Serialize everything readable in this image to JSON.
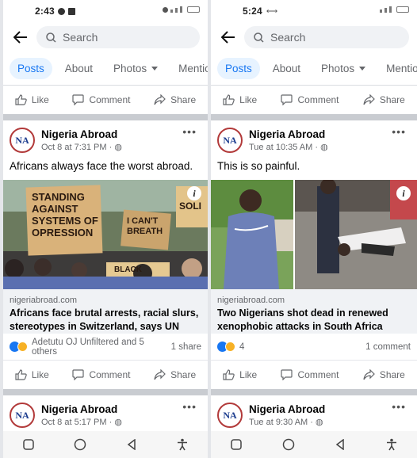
{
  "left": {
    "status": {
      "time": "2:43"
    },
    "search": {
      "placeholder": "Search"
    },
    "tabs": [
      {
        "label": "Posts"
      },
      {
        "label": "About"
      },
      {
        "label": "Photos"
      },
      {
        "label": "Mentions"
      }
    ],
    "actions": {
      "like": "Like",
      "comment": "Comment",
      "share": "Share"
    },
    "post1": {
      "author": "Nigeria Abroad",
      "avatar_text": "NA",
      "time": "Oct 8 at 7:31 PM",
      "text": "Africans always face the worst abroad.",
      "sign_text_1": "STANDING AGAINST SYSTEMS OF OPRESSION",
      "sign_text_2": "I CAN'T BREATH",
      "sign_text_3": "SOLI",
      "sign_text_4": "BLACK",
      "domain": "nigeriabroad.com",
      "title": "Africans face brutal arrests, racial slurs, stereotypes in Switzerland, says UN",
      "reactions": "Adetutu OJ Unfiltered and 5 others",
      "shares": "1 share"
    },
    "post2": {
      "author": "Nigeria Abroad",
      "avatar_text": "NA",
      "time": "Oct 8 at 5:17 PM"
    }
  },
  "right": {
    "status": {
      "time": "5:24"
    },
    "search": {
      "placeholder": "Search"
    },
    "tabs": [
      {
        "label": "Posts"
      },
      {
        "label": "About"
      },
      {
        "label": "Photos"
      },
      {
        "label": "Mentions"
      }
    ],
    "actions": {
      "like": "Like",
      "comment": "Comment",
      "share": "Share"
    },
    "post1": {
      "author": "Nigeria Abroad",
      "avatar_text": "NA",
      "time": "Tue at 10:35 AM",
      "text": "This is so painful.",
      "domain": "nigeriabroad.com",
      "title": "Two Nigerians shot dead in renewed xenophobic attacks in South Africa",
      "reactions": "4",
      "comments": "1 comment"
    },
    "post2": {
      "author": "Nigeria Abroad",
      "avatar_text": "NA",
      "time": "Tue at 9:30 AM"
    }
  },
  "colors": {
    "accent": "#1877f2",
    "active_tab_bg": "#e7f3ff",
    "link_box_bg": "#f0f2f5",
    "divider": "#c9ccd1"
  }
}
